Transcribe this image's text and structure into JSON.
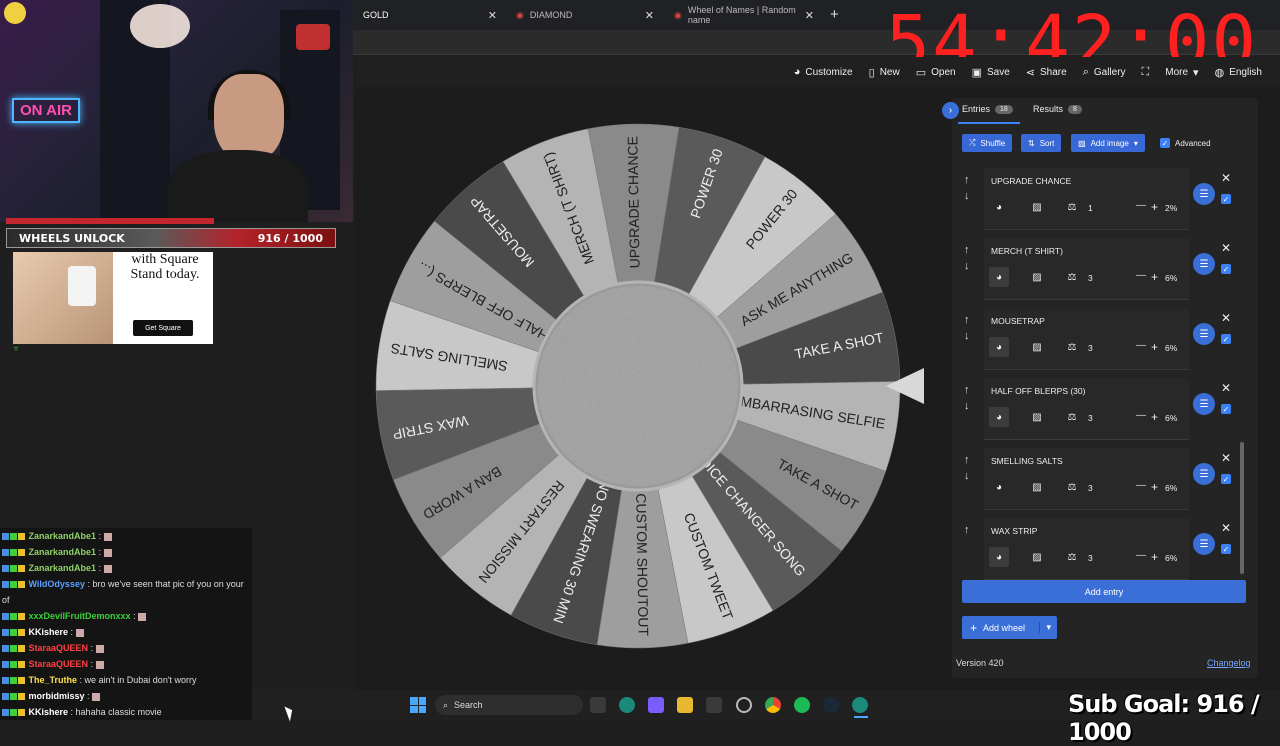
{
  "browser": {
    "tabs": [
      {
        "label": "GOLD"
      },
      {
        "label": "DIAMOND"
      },
      {
        "label": "Wheel of Names | Random name"
      }
    ],
    "timer": "54:42:00"
  },
  "toolbar": {
    "customize": "Customize",
    "new": "New",
    "open": "Open",
    "save": "Save",
    "share": "Share",
    "gallery": "Gallery",
    "more": "More",
    "language": "English"
  },
  "wheel": {
    "segments": [
      "UPGRADE CHANCE",
      "POWER 30",
      "POWER 30",
      "ASK ME ANYTHING",
      "TAKE A SHOT",
      "EMBARRASING SELFIE",
      "TAKE A SHOT",
      "VOICE CHANGER SONG",
      "CUSTOM TWEET",
      "CUSTOM SHOUTOUT",
      "NO SWEARING 30 MIN",
      "RESTART MISSION",
      "BAN A WORD",
      "WAX STRIP",
      "SMELLING SALTS",
      "HALF OFF BLERPS (...",
      "MOUSETRAP",
      "MERCH (T SHIRT)"
    ]
  },
  "panel": {
    "tab_entries": "Entries",
    "entries_count": "18",
    "tab_results": "Results",
    "results_count": "8",
    "shuffle": "Shuffle",
    "sort": "Sort",
    "add_image": "Add image",
    "advanced": "Advanced",
    "entries": [
      {
        "name": "UPGRADE CHANCE",
        "weight": "1",
        "pct": "2%"
      },
      {
        "name": "MERCH (T SHIRT)",
        "weight": "3",
        "pct": "6%"
      },
      {
        "name": "MOUSETRAP",
        "weight": "3",
        "pct": "6%"
      },
      {
        "name": "HALF OFF BLERPS (30)",
        "weight": "3",
        "pct": "6%"
      },
      {
        "name": "SMELLING SALTS",
        "weight": "3",
        "pct": "6%"
      },
      {
        "name": "WAX STRIP",
        "weight": "3",
        "pct": "6%"
      }
    ],
    "add_entry": "Add entry",
    "add_wheel": "Add wheel",
    "version": "Version 420",
    "changelog": "Changelog"
  },
  "overlay": {
    "on_air": "ON AIR",
    "unlock_label": "WHEELS UNLOCK",
    "unlock_value": "916 / 1000",
    "ad_text": "with Square Stand today.",
    "ad_button": "Get Square",
    "sub_goal": "Sub Goal: 916 / 1000"
  },
  "chat": [
    {
      "user": "ZanarkandAbe1",
      "color": "#8fd16a",
      "msg": ""
    },
    {
      "user": "ZanarkandAbe1",
      "color": "#8fd16a",
      "msg": ""
    },
    {
      "user": "ZanarkandAbe1",
      "color": "#8fd16a",
      "msg": ""
    },
    {
      "user": "WildOdyssey",
      "color": "#5aa0ff",
      "msg": "bro we've seen that pic of you on your of"
    },
    {
      "user": "xxxDevilFruitDemonxxx",
      "color": "#3ad13a",
      "msg": ""
    },
    {
      "user": "KKishere",
      "color": "#ffffff",
      "msg": ""
    },
    {
      "user": "StaraaQUEEN",
      "color": "#ff4040",
      "msg": ""
    },
    {
      "user": "StaraaQUEEN",
      "color": "#ff4040",
      "msg": ""
    },
    {
      "user": "The_Truthe",
      "color": "#ffe14a",
      "msg": "we ain't in Dubai don't worry"
    },
    {
      "user": "morbidmissy",
      "color": "#ffffff",
      "msg": ""
    },
    {
      "user": "KKishere",
      "color": "#ffffff",
      "msg": "hahaha classic movie"
    }
  ],
  "taskbar": {
    "search": "Search"
  }
}
